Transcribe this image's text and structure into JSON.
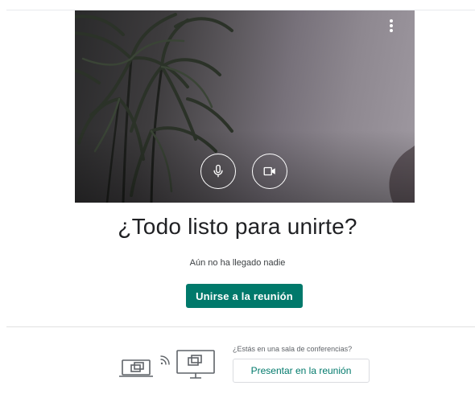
{
  "preview": {
    "more_options_icon": "more-vert-icon",
    "mic_icon": "microphone-icon",
    "camera_icon": "videocam-icon"
  },
  "main": {
    "title": "¿Todo listo para unirte?",
    "status": "Aún no ha llegado nadie",
    "join_label": "Unirse a la reunión"
  },
  "conference": {
    "question": "¿Estás en una sala de conferencias?",
    "present_label": "Presentar en la reunión",
    "illustration_icons": [
      "laptop-icon",
      "cast-signal-icon",
      "monitor-icon"
    ]
  },
  "colors": {
    "accent": "#00796b",
    "text": "#202124",
    "muted": "#5f6368",
    "border": "#dadce0"
  }
}
